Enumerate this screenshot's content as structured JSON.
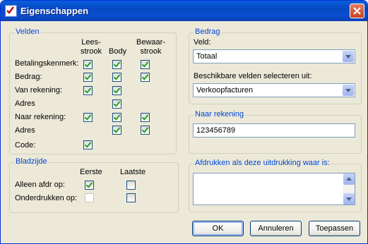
{
  "window": {
    "title": "Eigenschappen"
  },
  "velden": {
    "legend": "Velden",
    "col_headers": {
      "lees_1": "Lees-",
      "lees_2": "strook",
      "body": "Body",
      "bewaar_1": "Bewaar-",
      "bewaar_2": "strook"
    },
    "rows": [
      {
        "label": "Betalingskenmerk:"
      },
      {
        "label": "Bedrag:"
      },
      {
        "label": "Van rekening:"
      },
      {
        "label": "Adres"
      },
      {
        "label": "Naar rekening:"
      },
      {
        "label": "Adres"
      },
      {
        "label": "Code:"
      }
    ]
  },
  "bladzijde": {
    "legend": "Bladzijde",
    "col_headers": {
      "eerste": "Eerste",
      "laatste": "Laatste"
    },
    "rows": [
      {
        "label": "Alleen afdr op:"
      },
      {
        "label": "Onderdrukken op:"
      }
    ]
  },
  "bedrag": {
    "legend": "Bedrag",
    "veld_label": "Veld:",
    "veld_value": "Totaal",
    "beschikbare_label": "Beschikbare velden selecteren uit:",
    "beschikbare_value": "Verkoopfacturen"
  },
  "naar_rekening": {
    "legend": "Naar rekening",
    "value": "123456789"
  },
  "afdrukken": {
    "legend": "Afdrukken als deze uitdrukking waar is:",
    "value": ""
  },
  "buttons": {
    "ok": "OK",
    "annuleren": "Annuleren",
    "toepassen": "Toepassen"
  }
}
